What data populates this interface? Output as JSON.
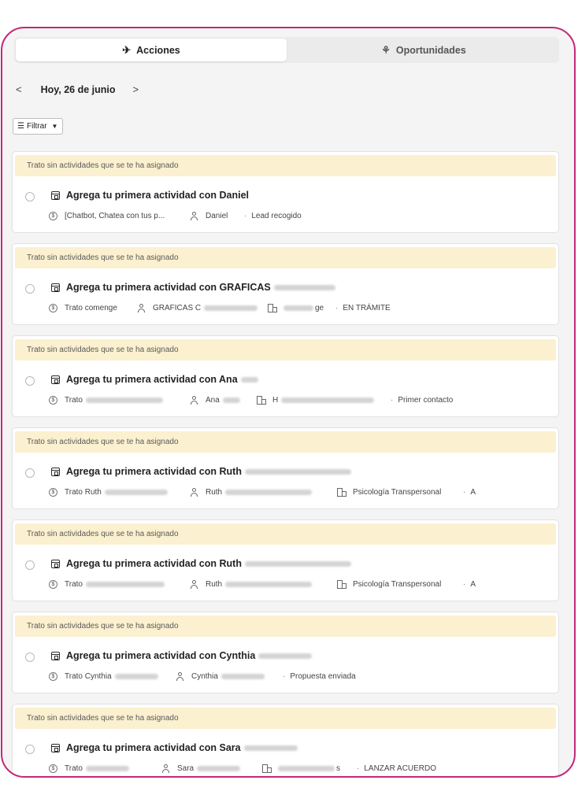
{
  "tabs": [
    {
      "label": "Acciones",
      "icon": "rocket-icon",
      "active": true
    },
    {
      "label": "Oportunidades",
      "icon": "handshake-icon",
      "active": false
    }
  ],
  "date_nav": {
    "prev": "<",
    "label": "Hoy, 26 de junio",
    "next": ">"
  },
  "filter": {
    "label": "Filtrar",
    "icon": "filter-lines-icon"
  },
  "banner_text": "Trato sin actividades que se te ha asignado",
  "cards": [
    {
      "title": "Agrega tu primera actividad con Daniel",
      "deal": "[Chatbot, Chatea con tus p...",
      "contact": "Daniel",
      "org": "",
      "stage": "Lead recogido"
    },
    {
      "title": "Agrega tu primera actividad con GRAFICAS",
      "deal": "Trato comenge",
      "contact": "GRAFICAS C",
      "org": "ge",
      "stage": "EN TRÁMITE"
    },
    {
      "title": "Agrega tu primera actividad con Ana",
      "deal": "Trato",
      "contact": "Ana",
      "org": "H",
      "stage": "Primer contacto"
    },
    {
      "title": "Agrega tu primera actividad con Ruth",
      "deal": "Trato Ruth",
      "contact": "Ruth",
      "org": "Psicología Transpersonal",
      "stage": "A"
    },
    {
      "title": "Agrega tu primera actividad con Ruth",
      "deal": "Trato",
      "contact": "Ruth",
      "org": "Psicología Transpersonal",
      "stage": "A"
    },
    {
      "title": "Agrega tu primera actividad con Cynthia",
      "deal": "Trato Cynthia",
      "contact": "Cynthia",
      "org": "",
      "stage": "Propuesta enviada"
    },
    {
      "title": "Agrega tu primera actividad con Sara",
      "deal": "Trato",
      "contact": "Sara",
      "org": "s",
      "stage": "LANZAR ACUERDO"
    }
  ]
}
